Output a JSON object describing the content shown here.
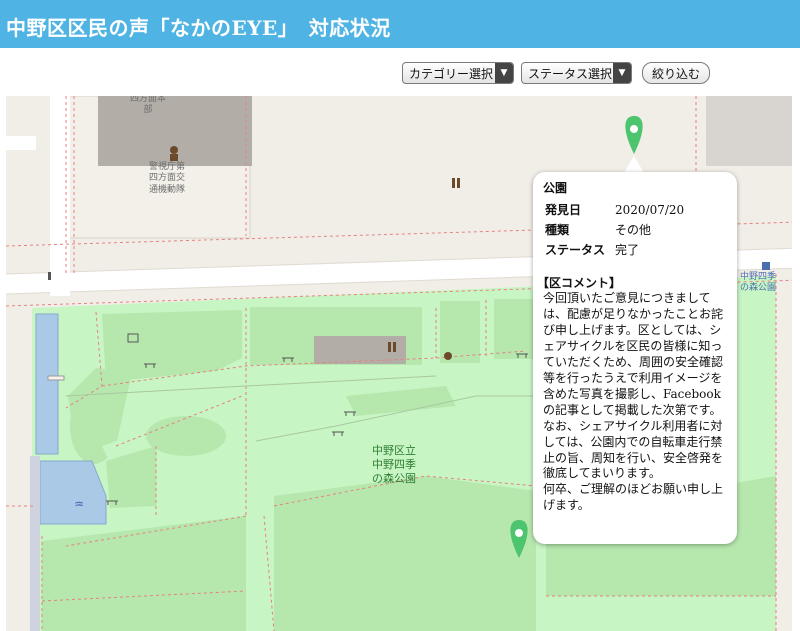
{
  "header": {
    "title": "中野区区民の声「なかのEYE」　対応状況"
  },
  "filters": {
    "category_label": "カテゴリー選択",
    "status_label": "ステータス選択",
    "submit_label": "絞り込む"
  },
  "map": {
    "labels": {
      "block_top": "四方面本\n部",
      "police": "警視庁第\n四方面交\n通機動隊",
      "park": "中野区立\n中野四季\nの森公園",
      "station": "中野四季\nの森公園"
    },
    "markers": [
      "map-pin-icon",
      "map-pin-icon"
    ],
    "colors": {
      "park": "#c8f5c4",
      "lawn": "#b6e8ad",
      "building": "#b0aaa4",
      "pin": "#4dc46e",
      "path": "#e88080"
    }
  },
  "popup": {
    "type": "公園",
    "details": [
      {
        "key": "発見日",
        "value": "2020/07/20"
      },
      {
        "key": "種類",
        "value": "その他"
      },
      {
        "key": "ステータス",
        "value": "完了"
      }
    ],
    "comment_heading": "【区コメント】",
    "comment": "今回頂いたご意見につきましては、配慮が足りなかったことお詫び申し上げます。区としては、シェアサイクルを区民の皆様に知っていただくため、周囲の安全確認等を行ったうえで利用イメージを含めた写真を撮影し、Facebookの記事として掲載した次第です。\nなお、シェアサイクル利用者に対しては、公園内での自転車走行禁止の旨、周知を行い、安全啓発を徹底してまいります。\n何卒、ご理解のほどお願い申し上げます。"
  }
}
